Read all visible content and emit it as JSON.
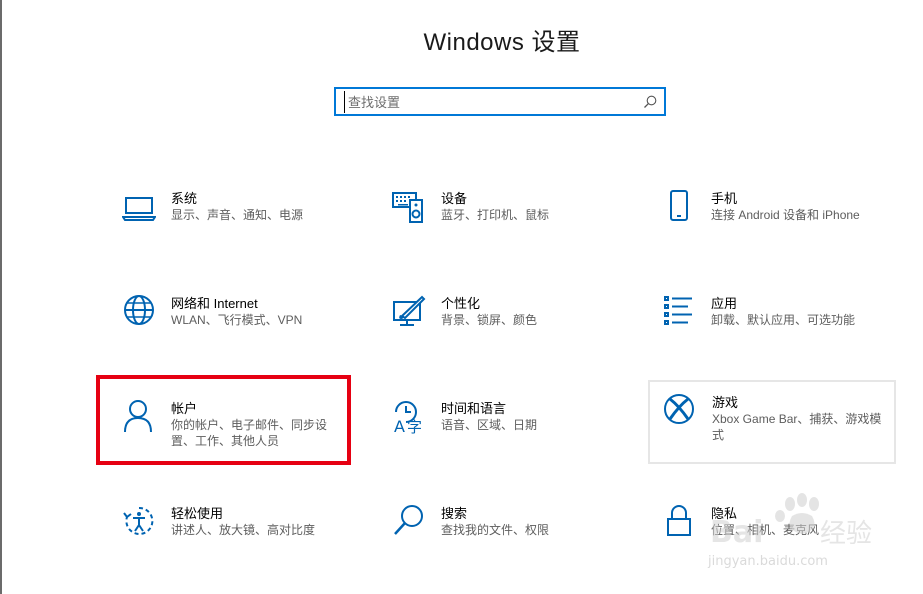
{
  "header": {
    "title": "Windows 设置"
  },
  "search": {
    "placeholder": "查找设置"
  },
  "colors": {
    "accent": "#0078d7",
    "highlight": "#e60012",
    "desc_text": "#5d5d5d"
  },
  "tiles": [
    {
      "icon": "laptop-icon",
      "name": "系统",
      "desc": "显示、声音、通知、电源"
    },
    {
      "icon": "keyboard-speaker-icon",
      "name": "设备",
      "desc": "蓝牙、打印机、鼠标"
    },
    {
      "icon": "phone-icon",
      "name": "手机",
      "desc": "连接 Android 设备和 iPhone"
    },
    {
      "icon": "globe-icon",
      "name": "网络和 Internet",
      "desc": "WLAN、飞行模式、VPN"
    },
    {
      "icon": "paint-monitor-icon",
      "name": "个性化",
      "desc": "背景、锁屏、颜色"
    },
    {
      "icon": "app-list-icon",
      "name": "应用",
      "desc": "卸载、默认应用、可选功能"
    },
    {
      "icon": "person-icon",
      "name": "帐户",
      "desc": "你的帐户、电子邮件、同步设置、工作、其他人员"
    },
    {
      "icon": "time-language-icon",
      "name": "时间和语言",
      "desc": "语音、区域、日期"
    },
    {
      "icon": "xbox-icon",
      "name": "游戏",
      "desc": "Xbox Game Bar、捕获、游戏模式"
    },
    {
      "icon": "ease-of-access-icon",
      "name": "轻松使用",
      "desc": "讲述人、放大镜、高对比度"
    },
    {
      "icon": "magnifier-icon",
      "name": "搜索",
      "desc": "查找我的文件、权限"
    },
    {
      "icon": "lock-icon",
      "name": "隐私",
      "desc": "位置、相机、麦克风"
    }
  ],
  "watermark": {
    "text": "jingyan.baidu.com"
  }
}
